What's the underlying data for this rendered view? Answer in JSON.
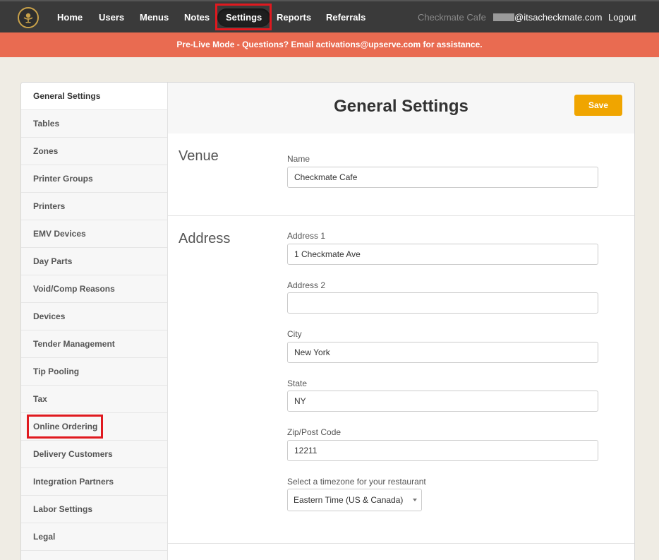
{
  "nav": {
    "items": [
      {
        "label": "Home"
      },
      {
        "label": "Users"
      },
      {
        "label": "Menus"
      },
      {
        "label": "Notes"
      },
      {
        "label": "Settings"
      },
      {
        "label": "Reports"
      },
      {
        "label": "Referrals"
      }
    ],
    "venue_name": "Checkmate Cafe",
    "email_suffix": "@itsacheckmate.com",
    "logout": "Logout"
  },
  "banner": "Pre-Live Mode - Questions? Email activations@upserve.com for assistance.",
  "sidebar": {
    "items": [
      {
        "label": "General Settings"
      },
      {
        "label": "Tables"
      },
      {
        "label": "Zones"
      },
      {
        "label": "Printer Groups"
      },
      {
        "label": "Printers"
      },
      {
        "label": "EMV Devices"
      },
      {
        "label": "Day Parts"
      },
      {
        "label": "Void/Comp Reasons"
      },
      {
        "label": "Devices"
      },
      {
        "label": "Tender Management"
      },
      {
        "label": "Tip Pooling"
      },
      {
        "label": "Tax"
      },
      {
        "label": "Online Ordering"
      },
      {
        "label": "Delivery Customers"
      },
      {
        "label": "Integration Partners"
      },
      {
        "label": "Labor Settings"
      },
      {
        "label": "Legal"
      }
    ]
  },
  "main": {
    "title": "General Settings",
    "save_label": "Save",
    "venue": {
      "title": "Venue",
      "name_label": "Name",
      "name_value": "Checkmate Cafe"
    },
    "address": {
      "title": "Address",
      "address1_label": "Address 1",
      "address1_value": "1 Checkmate Ave",
      "address2_label": "Address 2",
      "address2_value": "",
      "city_label": "City",
      "city_value": "New York",
      "state_label": "State",
      "state_value": "NY",
      "zip_label": "Zip/Post Code",
      "zip_value": "12211",
      "timezone_label": "Select a timezone for your restaurant",
      "timezone_value": "Eastern Time (US & Canada)"
    }
  },
  "colors": {
    "nav_bg": "#3a3a3a",
    "banner_bg": "#e96b51",
    "save_bg": "#f0a500",
    "highlight": "#e0191f"
  }
}
